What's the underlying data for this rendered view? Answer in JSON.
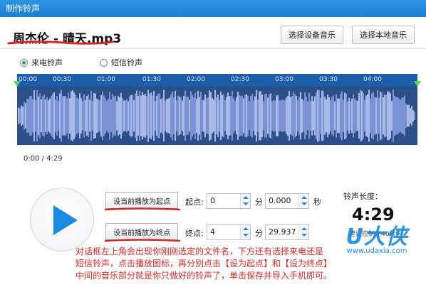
{
  "window": {
    "title": "制作铃声"
  },
  "file": {
    "name": "周杰伦 - 晴天.mp3"
  },
  "buttons": {
    "choose_device": "选择设备音乐",
    "choose_local": "选择本地音乐"
  },
  "ringtone_type": {
    "options": [
      "来电铃声",
      "短信铃声"
    ],
    "selected": "来电铃声"
  },
  "timeline": {
    "ticks": [
      "00:00",
      "00:30",
      "01:00",
      "01:30",
      "02:00",
      "02:30",
      "03:00",
      "03:30",
      "04:00"
    ]
  },
  "player": {
    "timecode": "0:00 / 4:29"
  },
  "range": {
    "set_start_label": "设当前播放为起点",
    "set_end_label": "设当前播放为终点",
    "start_label": "起点:",
    "end_label": "终点:",
    "start_min": "0",
    "start_sec": "0.000",
    "end_min": "4",
    "end_sec": "29.937",
    "min_unit": "分",
    "sec_unit": "秒"
  },
  "length": {
    "label": "铃声长度：",
    "value": "4:29",
    "hint": "建议控制在40秒内"
  },
  "annotation": {
    "lines": [
      "对话框左上角会出现你刚刚选定的文件名，下方还有选择来电还是",
      "短信铃声，点击播放图标，再分别点击【设为起点】和【设为终点】",
      "中间的音乐部分就是你只做好的铃声了，单击保存并导入手机即可。"
    ]
  },
  "watermark": {
    "logo": "U大侠",
    "url": "www.udaxia.com"
  },
  "colors": {
    "accent": "#1d7fd0",
    "annotation": "#d42a2a",
    "radio_on": "#1aa260",
    "marker": "#5fd16a"
  }
}
